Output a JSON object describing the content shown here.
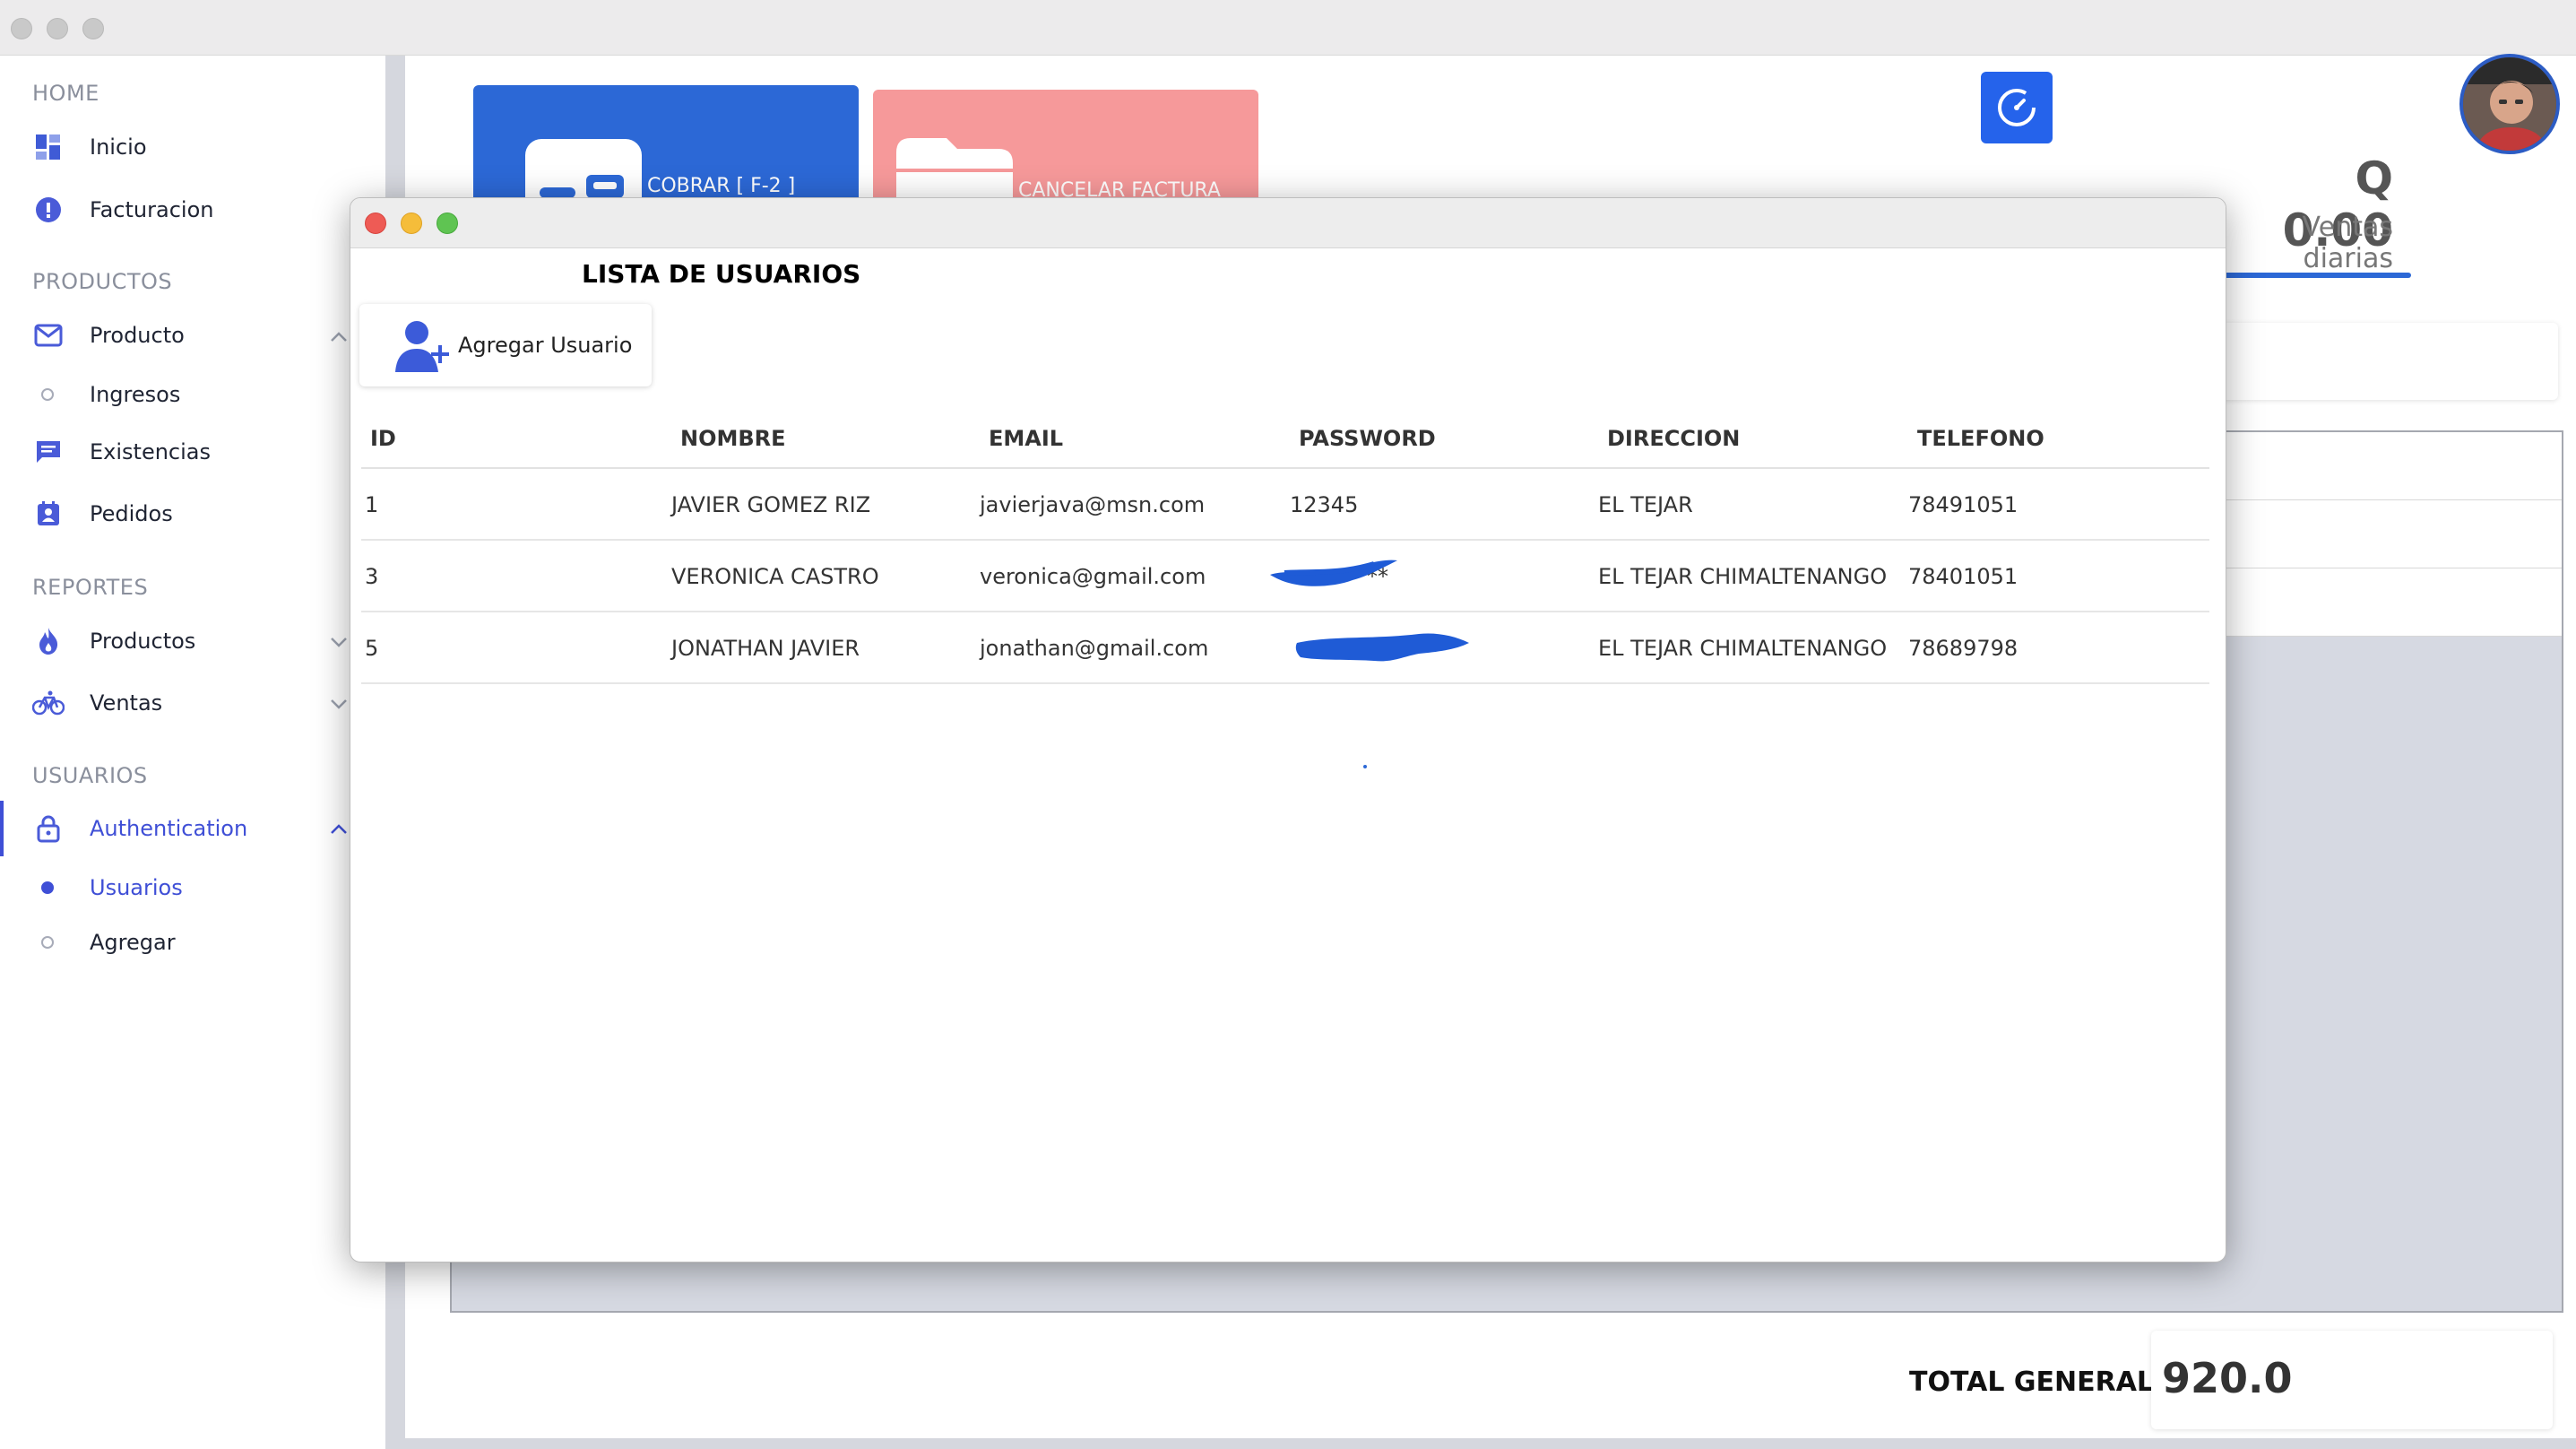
{
  "sidebar": {
    "sections": [
      {
        "title": "HOME",
        "items": [
          {
            "label": "Inicio",
            "icon": "dashboard-icon"
          },
          {
            "label": "Facturacion",
            "icon": "alert-circle-icon"
          }
        ]
      },
      {
        "title": "PRODUCTOS",
        "items": [
          {
            "label": "Producto",
            "icon": "mail-icon"
          },
          {
            "label": "Ingresos"
          },
          {
            "label": "Existencias",
            "icon": "message-icon"
          },
          {
            "label": "Pedidos",
            "icon": "contact-calendar-icon"
          }
        ]
      },
      {
        "title": "REPORTES",
        "items": [
          {
            "label": "Productos",
            "icon": "flame-icon"
          },
          {
            "label": "Ventas",
            "icon": "bicycle-icon"
          }
        ]
      },
      {
        "title": "USUARIOS",
        "items": [
          {
            "label": "Authentication",
            "icon": "lock-icon"
          },
          {
            "label": "Usuarios"
          },
          {
            "label": "Agregar"
          }
        ]
      }
    ],
    "active_item": "Usuarios",
    "accent_color": "#3f4fd6"
  },
  "toolbar": {
    "cobrar_label": "COBRAR [ F-2 ]",
    "cancelar_label": "CANCELAR FACTURA"
  },
  "sales": {
    "amount": "Q 0.00",
    "label": "Ventas diarias"
  },
  "totals": {
    "label": "TOTAL GENERAL",
    "value": "920.0"
  },
  "dialog": {
    "title": "LISTA DE USUARIOS",
    "add_button_label": "Agregar Usuario",
    "columns": [
      "ID",
      "NOMBRE",
      "EMAIL",
      "PASSWORD",
      "DIRECCION",
      "TELEFONO"
    ],
    "rows": [
      {
        "id": "1",
        "nombre": "JAVIER GOMEZ RIZ",
        "email": "javierjava@msn.com",
        "password": "12345",
        "direccion": "EL TEJAR",
        "telefono": "78491051"
      },
      {
        "id": "3",
        "nombre": "VERONICA CASTRO",
        "email": "veronica@gmail.com",
        "password": "**",
        "direccion": "EL TEJAR CHIMALTENANGO",
        "telefono": "78401051"
      },
      {
        "id": "5",
        "nombre": "JONATHAN JAVIER",
        "email": "jonathan@gmail.com",
        "password": "",
        "direccion": "EL TEJAR CHIMALTENANGO",
        "telefono": "78689798"
      }
    ]
  },
  "colors": {
    "primary": "#2c68d6",
    "danger_light": "#f6999a",
    "redaction": "#1f5bd6"
  }
}
